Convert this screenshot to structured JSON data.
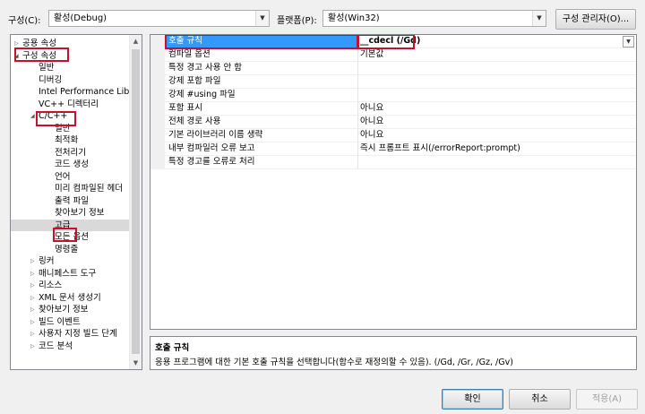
{
  "toolbar": {
    "config_label": "구성(C):",
    "config_value": "활성(Debug)",
    "platform_label": "플랫폼(P):",
    "platform_value": "활성(Win32)",
    "config_manager_label": "구성 관리자(O)..."
  },
  "tree": {
    "items": [
      {
        "label": "공용 속성",
        "arrow": "▷"
      },
      {
        "label": "구성 속성",
        "arrow": "◢"
      },
      {
        "label": "일반",
        "arrow": ""
      },
      {
        "label": "디버깅",
        "arrow": ""
      },
      {
        "label": "Intel Performance Libraries",
        "arrow": ""
      },
      {
        "label": "VC++ 디렉터리",
        "arrow": ""
      },
      {
        "label": "C/C++",
        "arrow": "◢"
      },
      {
        "label": "일반",
        "arrow": ""
      },
      {
        "label": "최적화",
        "arrow": ""
      },
      {
        "label": "전처리기",
        "arrow": ""
      },
      {
        "label": "코드 생성",
        "arrow": ""
      },
      {
        "label": "언어",
        "arrow": ""
      },
      {
        "label": "미리 컴파일된 헤더",
        "arrow": ""
      },
      {
        "label": "출력 파일",
        "arrow": ""
      },
      {
        "label": "찾아보기 정보",
        "arrow": ""
      },
      {
        "label": "고급",
        "arrow": ""
      },
      {
        "label": "모든 옵션",
        "arrow": ""
      },
      {
        "label": "명령줄",
        "arrow": ""
      },
      {
        "label": "링커",
        "arrow": "▷"
      },
      {
        "label": "매니페스트 도구",
        "arrow": "▷"
      },
      {
        "label": "리소스",
        "arrow": "▷"
      },
      {
        "label": "XML 문서 생성기",
        "arrow": "▷"
      },
      {
        "label": "찾아보기 정보",
        "arrow": "▷"
      },
      {
        "label": "빌드 이벤트",
        "arrow": "▷"
      },
      {
        "label": "사용자 지정 빌드 단계",
        "arrow": "▷"
      },
      {
        "label": "코드 분석",
        "arrow": "▷"
      }
    ]
  },
  "grid": {
    "rows": [
      {
        "name": "호출 규칙",
        "value": "__cdecl (/Gd)"
      },
      {
        "name": "컴파일 옵션",
        "value": "기본값"
      },
      {
        "name": "특정 경고 사용 안 함",
        "value": ""
      },
      {
        "name": "강제 포함 파일",
        "value": ""
      },
      {
        "name": "강제 #using 파일",
        "value": ""
      },
      {
        "name": "포함 표시",
        "value": "아니요"
      },
      {
        "name": "전체 경로 사용",
        "value": "아니요"
      },
      {
        "name": "기본 라이브러리 이름 생략",
        "value": "아니요"
      },
      {
        "name": "내부 컴파일러 오류 보고",
        "value": "즉시 프롬프트 표시(/errorReport:prompt)"
      },
      {
        "name": "특정 경고를 오류로 처리",
        "value": ""
      }
    ]
  },
  "description": {
    "title": "호출 규칙",
    "text": "응용 프로그램에 대한 기본 호출 규칙을 선택합니다(함수로 재정의할 수 있음).     (/Gd, /Gr, /Gz, /Gv)"
  },
  "buttons": {
    "ok": "확인",
    "cancel": "취소",
    "apply": "적용(A)"
  }
}
